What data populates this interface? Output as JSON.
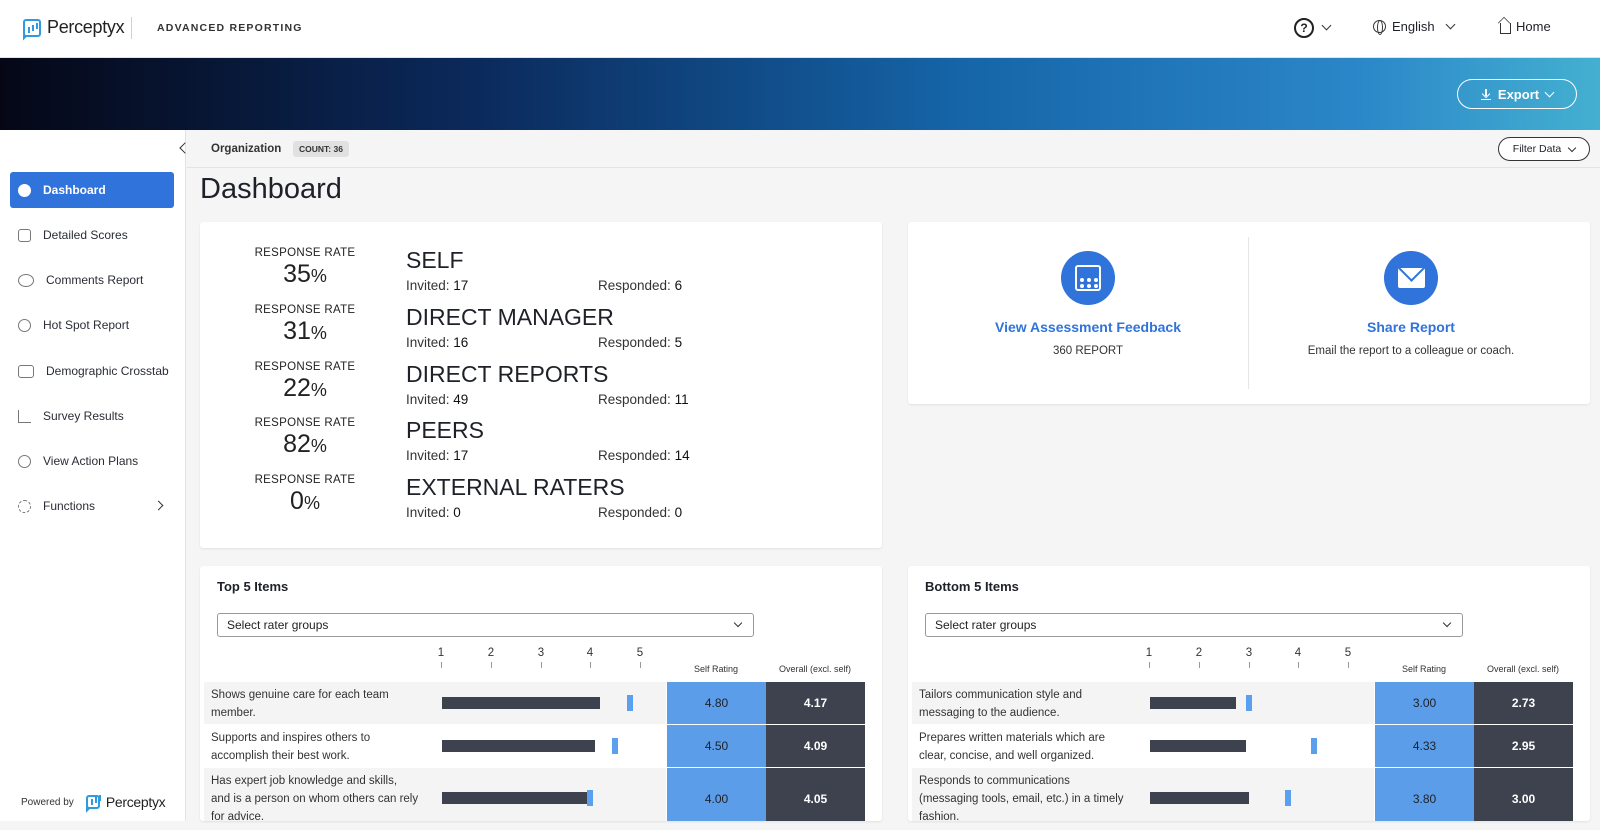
{
  "header": {
    "brand": "Perceptyx",
    "app_title": "ADVANCED REPORTING",
    "help_glyph": "?",
    "language": "English",
    "home": "Home"
  },
  "banner": {
    "export": "Export"
  },
  "sidebar": {
    "items": [
      {
        "label": "Dashboard",
        "icon": "dashboard-icon"
      },
      {
        "label": "Detailed Scores",
        "icon": "thumbs-up-icon"
      },
      {
        "label": "Comments Report",
        "icon": "chat-icon"
      },
      {
        "label": "Hot Spot Report",
        "icon": "target-icon"
      },
      {
        "label": "Demographic Crosstab",
        "icon": "scale-icon"
      },
      {
        "label": "Survey Results",
        "icon": "bar-chart-icon"
      },
      {
        "label": "View Action Plans",
        "icon": "check-circle-icon"
      },
      {
        "label": "Functions",
        "icon": "gear-icon"
      }
    ],
    "powered_by": "Powered by",
    "powered_brand": "Perceptyx"
  },
  "orgbar": {
    "label": "Organization",
    "count": "COUNT: 36",
    "filter": "Filter Data"
  },
  "page": {
    "title": "Dashboard"
  },
  "response": {
    "label": "RESPONSE RATE",
    "invited_label": "Invited:",
    "responded_label": "Responded:",
    "groups": [
      {
        "name": "SELF",
        "rate": "35",
        "pct": "%",
        "invited": "17",
        "responded": "6"
      },
      {
        "name": "DIRECT MANAGER",
        "rate": "31",
        "pct": "%",
        "invited": "16",
        "responded": "5"
      },
      {
        "name": "DIRECT REPORTS",
        "rate": "22",
        "pct": "%",
        "invited": "49",
        "responded": "11"
      },
      {
        "name": "PEERS",
        "rate": "82",
        "pct": "%",
        "invited": "17",
        "responded": "14"
      },
      {
        "name": "EXTERNAL RATERS",
        "rate": "0",
        "pct": "%",
        "invited": "0",
        "responded": "0"
      }
    ]
  },
  "actions": {
    "feedback": {
      "link": "View Assessment Feedback",
      "sub": "360 REPORT"
    },
    "share": {
      "link": "Share Report",
      "sub": "Email the report to a colleague or coach."
    }
  },
  "items": {
    "scale": [
      "1",
      "2",
      "3",
      "4",
      "5"
    ],
    "self_header": "Self Rating",
    "overall_header": "Overall (excl. self)",
    "select_placeholder": "Select rater groups",
    "top": {
      "title": "Top 5 Items",
      "rows": [
        {
          "line1": "Shows genuine care for each team",
          "line2": "member.",
          "line3": "",
          "self": "4.80",
          "overall": "4.17"
        },
        {
          "line1": "Supports and inspires others to",
          "line2": "accomplish their best work.",
          "line3": "",
          "self": "4.50",
          "overall": "4.09"
        },
        {
          "line1": "Has expert job knowledge and skills,",
          "line2": "and is a person on whom others can rely",
          "line3": "for advice.",
          "self": "4.00",
          "overall": "4.05"
        }
      ]
    },
    "bottom": {
      "title": "Bottom 5 Items",
      "rows": [
        {
          "line1": "Tailors communication style and",
          "line2": "messaging to the audience.",
          "line3": "",
          "self": "3.00",
          "overall": "2.73"
        },
        {
          "line1": "Prepares written materials which are",
          "line2": "clear, concise, and well organized.",
          "line3": "",
          "self": "4.33",
          "overall": "2.95"
        },
        {
          "line1": "Responds to communications",
          "line2": "(messaging tools, email, etc.) in a timely",
          "line3": "fashion.",
          "self": "3.80",
          "overall": "3.00"
        }
      ]
    }
  },
  "colors": {
    "accent": "#2f73db",
    "self_cell": "#5b9de9",
    "overall_cell": "#3e424e",
    "marker": "#5aa0ee"
  }
}
